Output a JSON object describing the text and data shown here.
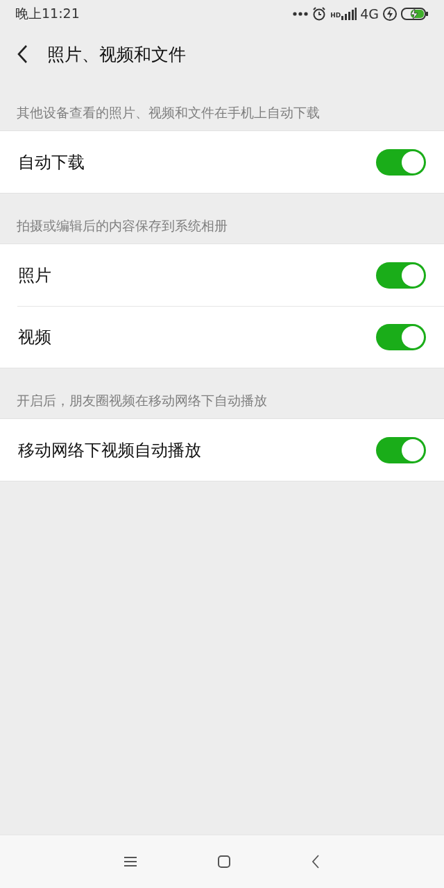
{
  "status_bar": {
    "time": "晚上11:21",
    "hd_label": "HD",
    "network": "4G"
  },
  "header": {
    "title": "照片、视频和文件"
  },
  "sections": [
    {
      "caption": "其他设备查看的照片、视频和文件在手机上自动下载",
      "rows": [
        {
          "label": "自动下载",
          "on": true
        }
      ]
    },
    {
      "caption": "拍摄或编辑后的内容保存到系统相册",
      "rows": [
        {
          "label": "照片",
          "on": true
        },
        {
          "label": "视频",
          "on": true
        }
      ]
    },
    {
      "caption": "开启后，朋友圈视频在移动网络下自动播放",
      "rows": [
        {
          "label": "移动网络下视频自动播放",
          "on": true
        }
      ]
    }
  ]
}
